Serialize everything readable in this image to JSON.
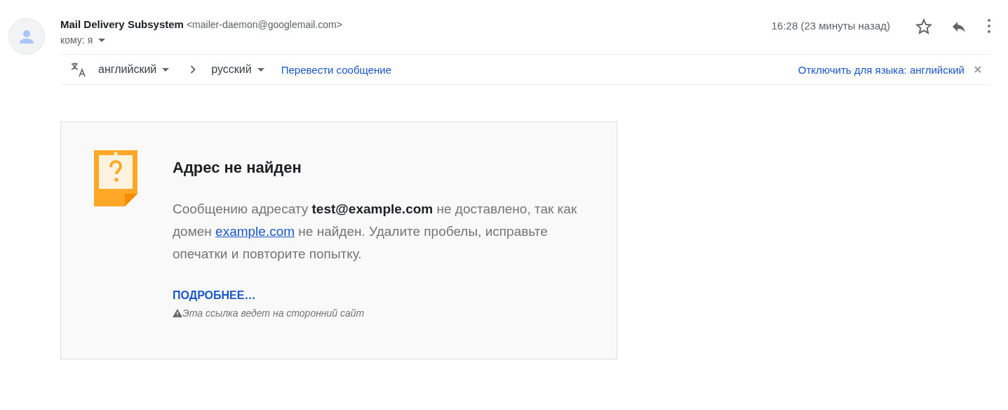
{
  "sender": {
    "name": "Mail Delivery Subsystem",
    "email": "<mailer-daemon@googlemail.com>",
    "recipient": "кому: я",
    "time": "16:28 (23 минуты назад)",
    "starred": false
  },
  "translation": {
    "source": "английский",
    "target": "русский",
    "translate": "Перевести сообщение",
    "disable": "Отключить для языка: английский"
  },
  "notice": {
    "title": "Адрес не найден",
    "body": {
      "before": "Сообщению адресату **test@example.com** не доставлено, так как домен ",
      "link": "example.com",
      "after": " не найден. Удалите пробелы, исправьте опечатки и повторите попытку."
    },
    "more": "ПОДРОБНЕЕ…",
    "warning": "Эта ссылка ведет на сторонний сайт"
  }
}
